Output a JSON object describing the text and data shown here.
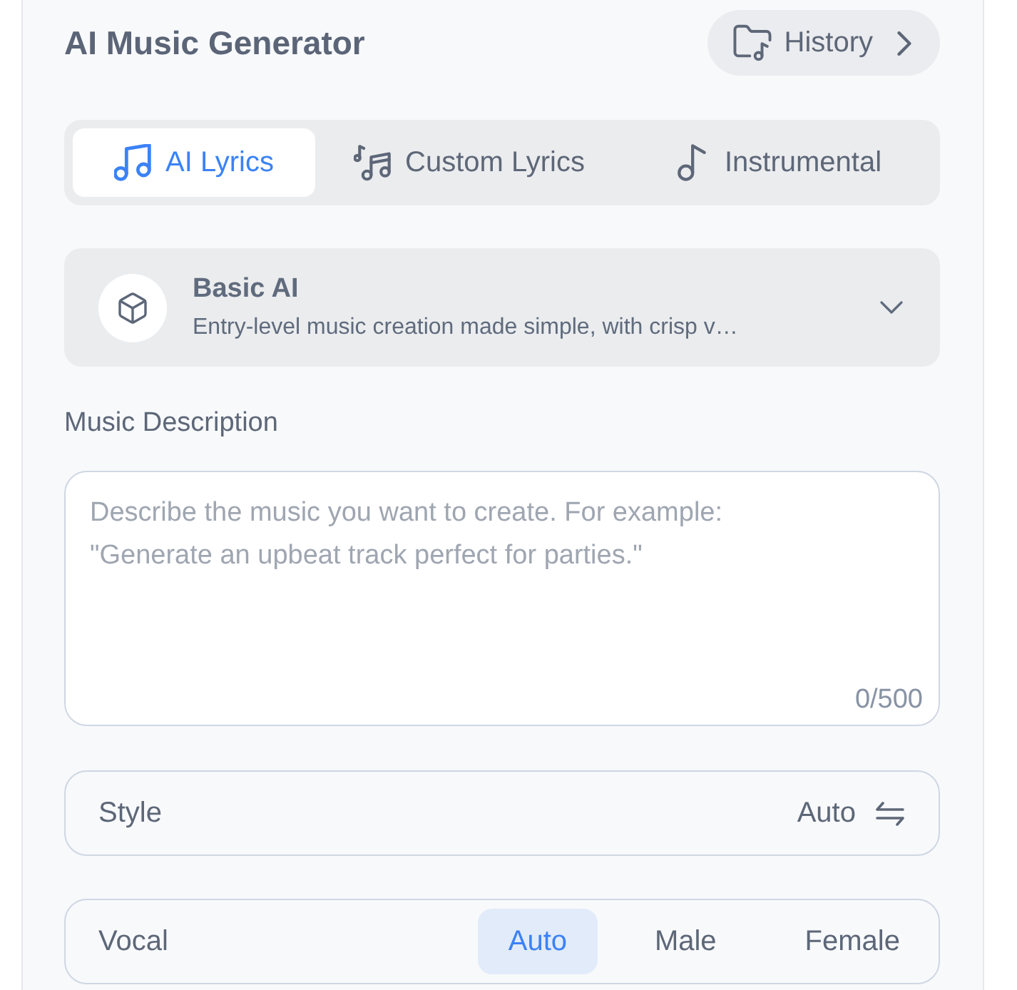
{
  "header": {
    "title": "AI Music Generator",
    "history_button": "History"
  },
  "tabs": [
    {
      "label": "AI Lyrics",
      "selected": true,
      "kind": "lyrics"
    },
    {
      "label": "Custom Lyrics",
      "selected": false,
      "kind": "custom"
    },
    {
      "label": "Instrumental",
      "selected": false,
      "kind": "instrumental"
    }
  ],
  "model_select": {
    "name": "Basic AI",
    "description": "Entry-level music creation made simple, with crisp v…"
  },
  "music_description": {
    "label": "Music Description",
    "placeholder": "Describe the music you want to create. For example:\n\"Generate an upbeat track perfect for parties.\"",
    "counter": "0/500"
  },
  "style": {
    "label": "Style",
    "value": "Auto"
  },
  "vocal": {
    "label": "Vocal",
    "options": [
      {
        "label": "Auto",
        "selected": true
      },
      {
        "label": "Male",
        "selected": false
      },
      {
        "label": "Female",
        "selected": false
      }
    ]
  }
}
